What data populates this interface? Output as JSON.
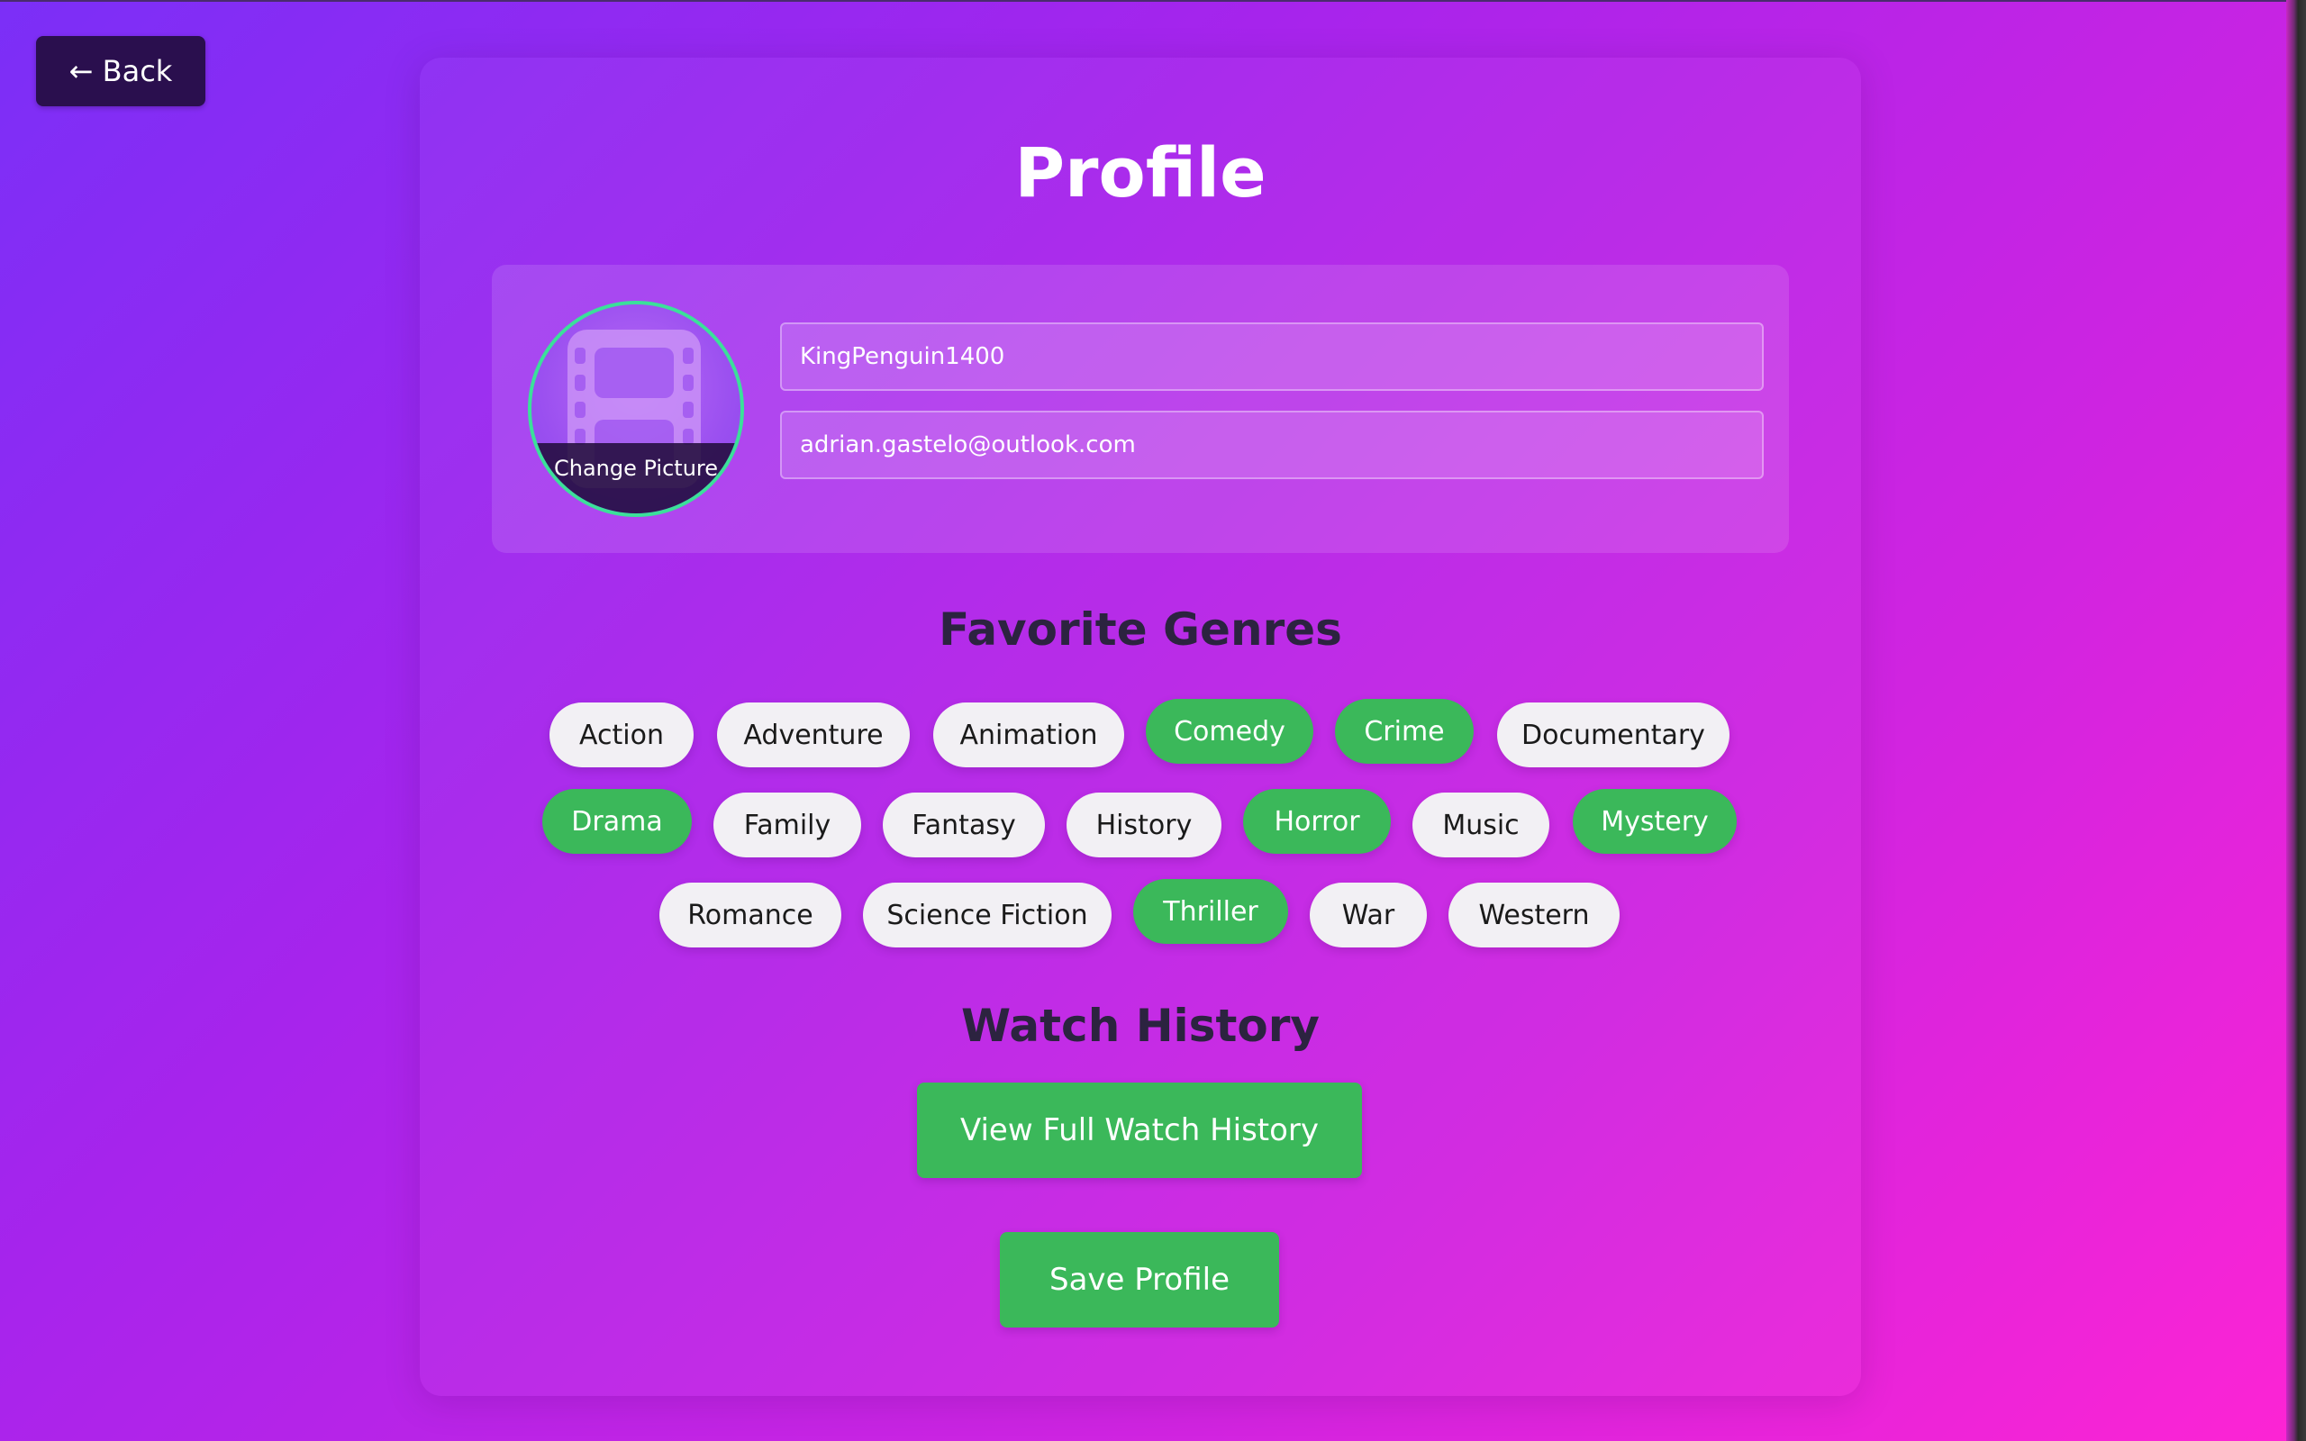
{
  "nav": {
    "back_label": "← Back"
  },
  "page": {
    "title": "Profile"
  },
  "profile": {
    "username": "KingPenguin1400",
    "email": "adrian.gastelo@outlook.com",
    "change_picture_label": "Change Picture",
    "avatar_icon": "film-icon"
  },
  "genres": {
    "title": "Favorite Genres",
    "items": [
      {
        "label": "Action",
        "selected": false
      },
      {
        "label": "Adventure",
        "selected": false
      },
      {
        "label": "Animation",
        "selected": false
      },
      {
        "label": "Comedy",
        "selected": true
      },
      {
        "label": "Crime",
        "selected": true
      },
      {
        "label": "Documentary",
        "selected": false
      },
      {
        "label": "Drama",
        "selected": true
      },
      {
        "label": "Family",
        "selected": false
      },
      {
        "label": "Fantasy",
        "selected": false
      },
      {
        "label": "History",
        "selected": false
      },
      {
        "label": "Horror",
        "selected": true
      },
      {
        "label": "Music",
        "selected": false
      },
      {
        "label": "Mystery",
        "selected": true
      },
      {
        "label": "Romance",
        "selected": false
      },
      {
        "label": "Science Fiction",
        "selected": false
      },
      {
        "label": "Thriller",
        "selected": true
      },
      {
        "label": "War",
        "selected": false
      },
      {
        "label": "Western",
        "selected": false
      }
    ]
  },
  "watch_history": {
    "title": "Watch History",
    "view_label": "View Full Watch History"
  },
  "actions": {
    "save_label": "Save Profile"
  },
  "colors": {
    "accent_green": "#3bb85a",
    "avatar_ring": "#3be09a",
    "back_button": "#2a0f4e",
    "gradient_start": "#7b2ff7",
    "gradient_end": "#fd24d4"
  }
}
